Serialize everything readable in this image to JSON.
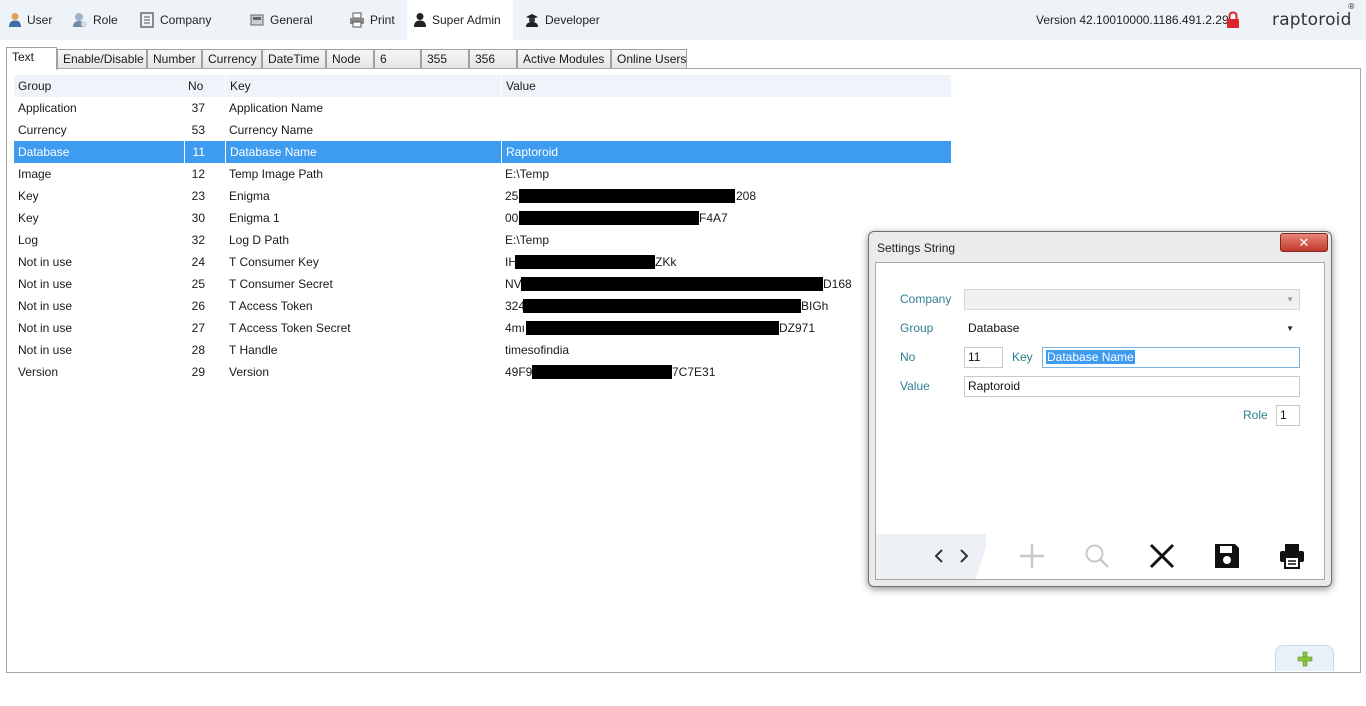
{
  "menu": {
    "items": [
      {
        "label": "User",
        "icon": "user-icon"
      },
      {
        "label": "Role",
        "icon": "role-icon"
      },
      {
        "label": "Company",
        "icon": "company-icon"
      },
      {
        "label": "General",
        "icon": "general-icon"
      },
      {
        "label": "Print",
        "icon": "print-icon"
      },
      {
        "label": "Super Admin",
        "icon": "super-admin-icon",
        "active": true
      },
      {
        "label": "Developer",
        "icon": "developer-icon"
      }
    ],
    "version": "Version 42.10010000.1186.491.2.29",
    "brand": "raptoroid",
    "brand_mark": "®"
  },
  "tabs": [
    "Text",
    "Enable/Disable",
    "Number",
    "Currency",
    "DateTime",
    "Node",
    "6",
    "355",
    "356",
    "Active Modules",
    "Online Users"
  ],
  "grid": {
    "headers": {
      "group": "Group",
      "no": "No",
      "key": "Key",
      "value": "Value"
    },
    "rows": [
      {
        "group": "Application",
        "no": "37",
        "key": "Application Name",
        "value": ""
      },
      {
        "group": "Currency",
        "no": "53",
        "key": "Currency Name",
        "value": ""
      },
      {
        "group": "Database",
        "no": "11",
        "key": "Database Name",
        "value": "Raptoroid",
        "selected": true
      },
      {
        "group": "Image",
        "no": "12",
        "key": "Temp Image Path",
        "value": "E:\\Temp"
      },
      {
        "group": "Key",
        "no": "23",
        "key": "Enigma",
        "value_start": "25(",
        "value_end": "208"
      },
      {
        "group": "Key",
        "no": "30",
        "key": "Enigma 1",
        "value_start": "00(",
        "value_end": "F4A7"
      },
      {
        "group": "Log",
        "no": "32",
        "key": "Log D Path",
        "value": "E:\\Temp"
      },
      {
        "group": "Not in use",
        "no": "24",
        "key": "T Consumer Key",
        "value_start": "IH",
        "value_end": "ZKk"
      },
      {
        "group": "Not in use",
        "no": "25",
        "key": "T Consumer Secret",
        "value_start": "NV",
        "value_end": "D168"
      },
      {
        "group": "Not in use",
        "no": "26",
        "key": "T Access Token",
        "value_start": "324",
        "value_end": "BIGh"
      },
      {
        "group": "Not in use",
        "no": "27",
        "key": "T Access Token Secret",
        "value_start": "4mı",
        "value_end": "DZ971"
      },
      {
        "group": "Not in use",
        "no": "28",
        "key": "T Handle",
        "value": "timesofindia"
      },
      {
        "group": "Version",
        "no": "29",
        "key": "Version",
        "value_start": "49F9:",
        "value_end": "7C7E31"
      }
    ]
  },
  "dialog": {
    "title": "Settings String",
    "close_label": "✕",
    "company_label": "Company",
    "company_value": "",
    "group_label": "Group",
    "group_value": "Database",
    "no_label": "No",
    "no_value": "11",
    "key_label": "Key",
    "key_value": "Database Name",
    "value_label": "Value",
    "value_value": "Raptoroid",
    "role_label": "Role",
    "role_value": "1"
  },
  "colors": {
    "accent": "#3d9bf0",
    "label": "#2f7f94",
    "lock": "#d9262c"
  }
}
